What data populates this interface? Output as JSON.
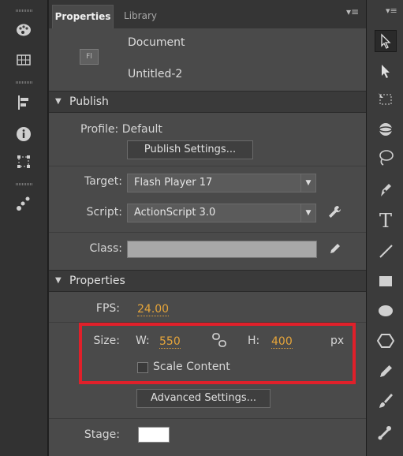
{
  "tabs": {
    "properties": "Properties",
    "library": "Library"
  },
  "document": {
    "type_label": "Document",
    "name": "Untitled-2",
    "icon_text": "Fl"
  },
  "publish": {
    "header": "Publish",
    "profile_label": "Profile:",
    "profile_value": "Default",
    "publish_settings_button": "Publish Settings...",
    "target_label": "Target:",
    "target_value": "Flash Player 17",
    "script_label": "Script:",
    "script_value": "ActionScript 3.0",
    "class_label": "Class:"
  },
  "properties": {
    "header": "Properties",
    "fps_label": "FPS:",
    "fps_value": "24.00",
    "size_label": "Size:",
    "w_label": "W:",
    "w_value": "550",
    "h_label": "H:",
    "h_value": "400",
    "unit": "px",
    "scale_content_label": "Scale Content",
    "advanced_settings_button": "Advanced Settings...",
    "stage_label": "Stage:",
    "stage_color": "#ffffff"
  },
  "colors": {
    "highlight": "#e0202a",
    "value_accent": "#e6a53a"
  },
  "left_tools": [
    "color-palette-icon",
    "grid-icon",
    "align-icon",
    "info-icon",
    "transform-icon",
    "motion-presets-icon"
  ],
  "right_tools": [
    "selection-tool-icon",
    "subselection-tool-icon",
    "free-transform-icon",
    "3d-rotation-icon",
    "lasso-icon",
    "pen-icon",
    "text-tool-icon",
    "line-tool-icon",
    "rectangle-tool-icon",
    "oval-tool-icon",
    "polystar-tool-icon",
    "pencil-icon",
    "brush-icon",
    "bone-tool-icon"
  ]
}
